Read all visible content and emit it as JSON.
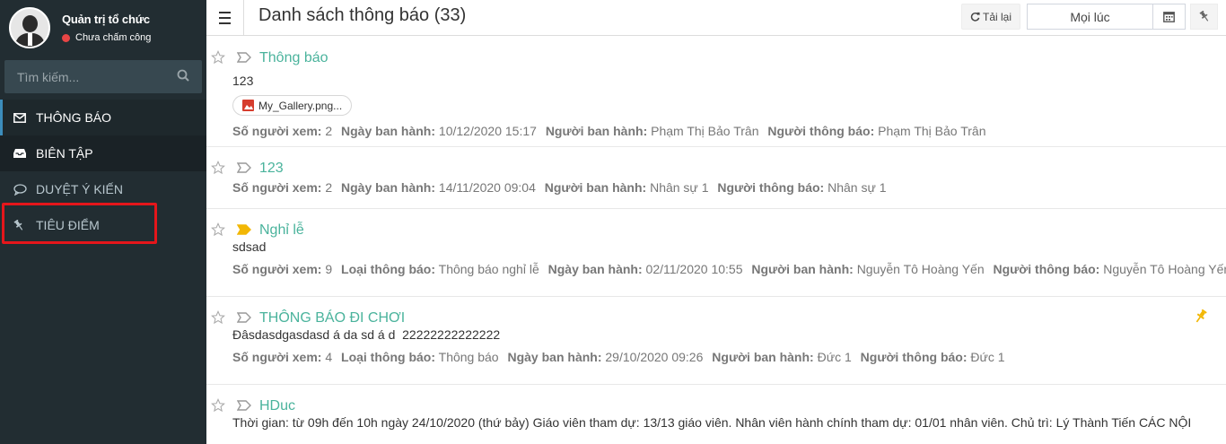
{
  "profile": {
    "name": "Quản trị tổ chức",
    "status": "Chưa chấm công"
  },
  "search": {
    "placeholder": "Tìm kiếm..."
  },
  "menu": [
    {
      "label": "THÔNG BÁO",
      "icon": "envelope-icon"
    },
    {
      "label": "BIÊN TẬP",
      "icon": "inbox-icon"
    },
    {
      "label": "DUYỆT Ý KIẾN",
      "icon": "comment-icon"
    },
    {
      "label": "TIÊU ĐIỂM",
      "icon": "pin-icon"
    }
  ],
  "header": {
    "title": "Danh sách thông báo (33)",
    "reload_label": "Tải lại",
    "range_value": "Mọi lúc"
  },
  "labels": {
    "viewers": "Số người xem:",
    "type": "Loại thông báo:",
    "date": "Ngày ban hành:",
    "issuer": "Người ban hành:",
    "notifier": "Người thông báo:"
  },
  "notices": [
    {
      "title": "Thông báo",
      "body": "123",
      "attachment": "My_Gallery.png...",
      "viewers": "2",
      "date": "10/12/2020 15:17",
      "issuer": "Phạm Thị Bảo Trân",
      "notifier": "Phạm Thị Bảo Trân"
    },
    {
      "title": "123",
      "viewers": "2",
      "date": "14/11/2020 09:04",
      "issuer": "Nhân sự 1",
      "notifier": "Nhân sự 1"
    },
    {
      "title": "Nghỉ lễ",
      "body": "sdsad",
      "viewers": "9",
      "type": "Thông báo nghỉ lễ",
      "date": "02/11/2020 10:55",
      "issuer": "Nguyễn Tô Hoàng Yến",
      "notifier": "Nguyễn Tô Hoàng Yến"
    },
    {
      "title": "THÔNG BÁO ĐI CHƠI",
      "body": "Đâsdasdgasdasd á da sd á d  22222222222222",
      "viewers": "4",
      "type": "Thông báo",
      "date": "29/10/2020 09:26",
      "issuer": "Đức 1",
      "notifier": "Đức 1"
    },
    {
      "title": "HDuc",
      "body": "Thời gian: từ 09h đến 10h ngày 24/10/2020 (thứ bảy) Giáo viên tham dự: 13/13 giáo viên. Nhân viên hành chính tham dự: 01/01 nhân viên. Chủ trì: Lý Thành Tiến CÁC NỘI"
    }
  ],
  "colors": {
    "accent": "#4ab39c",
    "sidebar": "#222d32",
    "highlight": "#e5161b",
    "tag_yellow": "#f2b705"
  }
}
